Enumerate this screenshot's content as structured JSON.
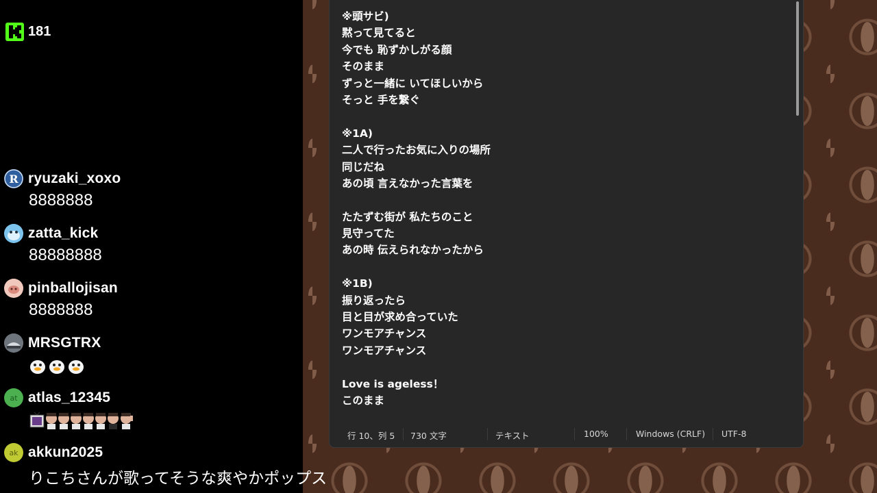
{
  "viewer_count": "181",
  "chat": [
    {
      "user": "ryuzaki_xoxo",
      "text": "8888888",
      "avatar_color": "#3a6fb0"
    },
    {
      "user": "zatta_kick",
      "text": "88888888",
      "avatar_color": "#7cc4ee"
    },
    {
      "user": "pinballojisan",
      "text": "8888888",
      "avatar_color": "#e8b4a8"
    },
    {
      "user": "MRSGTRX",
      "text": "",
      "avatar_color": "#8a8f96",
      "emotes": [
        "duck-emote",
        "duck-emote",
        "duck-emote"
      ]
    },
    {
      "user": "atlas_12345",
      "text": "",
      "avatar_color": "#4caf50",
      "avatar_text": "at",
      "emotes": [
        "tv-emote",
        "face-emote",
        "face-emote",
        "face-emote",
        "face-emote",
        "face-emote",
        "face-emote",
        "face-emote"
      ]
    },
    {
      "user": "akkun2025",
      "text": "りこちさんが歌ってそうな爽やかポップス",
      "avatar_color": "#c0ca33",
      "avatar_text": "ak"
    }
  ],
  "notepad": {
    "lines": [
      "※頭サビ)",
      "黙って見てると",
      "今でも 恥ずかしがる顔",
      "そのまま",
      "ずっと一緒に いてほしいから",
      "そっと 手を繋ぐ",
      "",
      "※1A)",
      "二人で行ったお気に入りの場所",
      "同じだね",
      "あの頃 言えなかった言葉を",
      "",
      "たたずむ街が 私たちのこと",
      "見守ってた",
      "あの時 伝えられなかったから",
      "",
      "※1B)",
      "振り返ったら",
      "目と目が求め合っていた",
      "ワンモアチャンス",
      "ワンモアチャンス",
      "",
      "Love is ageless！",
      "このまま"
    ],
    "status": {
      "position": "行 10、列 5",
      "chars": "730 文字",
      "format": "テキスト",
      "zoom": "100%",
      "line_ending": "Windows (CRLF)",
      "encoding": "UTF-8"
    }
  },
  "colors": {
    "kick_green": "#53fc18",
    "notepad_bg": "#272727",
    "pattern_bg": "#4a2c1f"
  }
}
